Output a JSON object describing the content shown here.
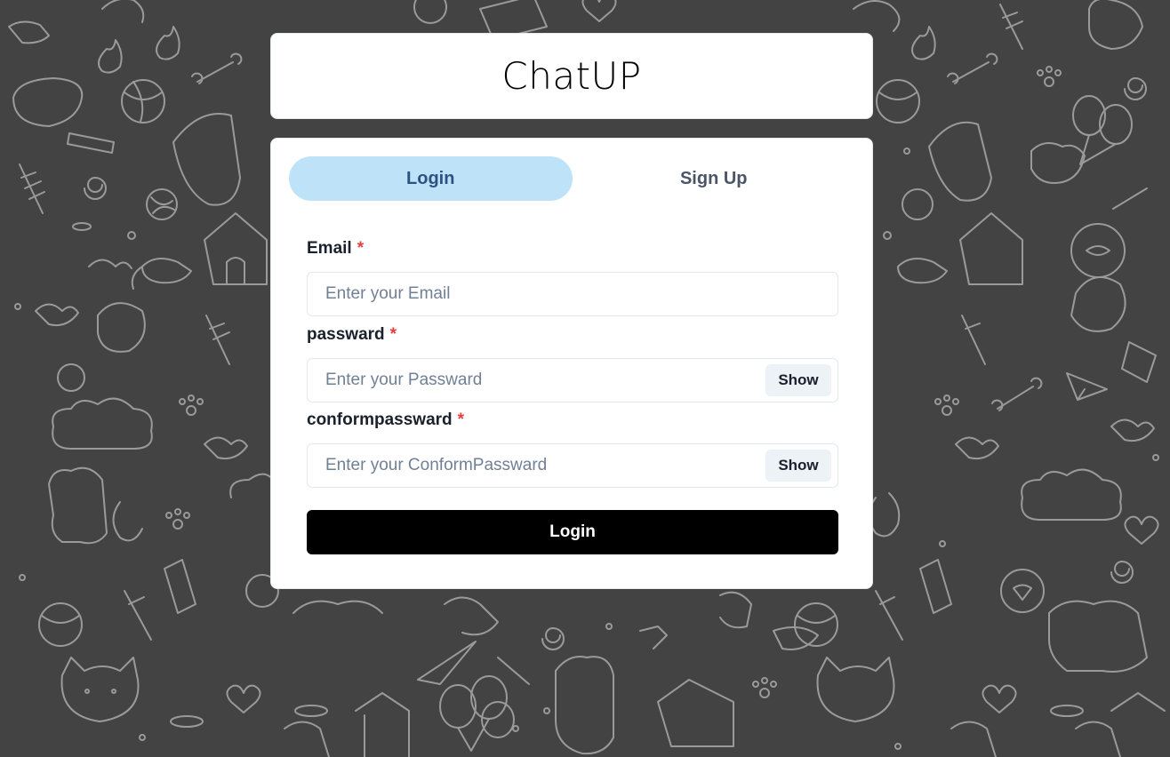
{
  "app": {
    "title": "ChatUP"
  },
  "tabs": [
    {
      "label": "Login",
      "active": true
    },
    {
      "label": "Sign Up",
      "active": false
    }
  ],
  "form": {
    "email": {
      "label": "Email",
      "required_mark": "*",
      "placeholder": "Enter your Email",
      "value": ""
    },
    "password": {
      "label": "passward",
      "required_mark": "*",
      "placeholder": "Enter your Passward",
      "value": "",
      "toggle_label": "Show"
    },
    "confirm_password": {
      "label": "conformpassward",
      "required_mark": "*",
      "placeholder": "Enter your ConformPassward",
      "value": "",
      "toggle_label": "Show"
    },
    "submit_label": "Login"
  },
  "colors": {
    "background": "#434343",
    "pattern_stroke": "#9a9a9a",
    "tab_active_bg": "#bee3f8",
    "tab_text": "#2c5282",
    "required": "#e53e3e",
    "submit_bg": "#000000"
  }
}
